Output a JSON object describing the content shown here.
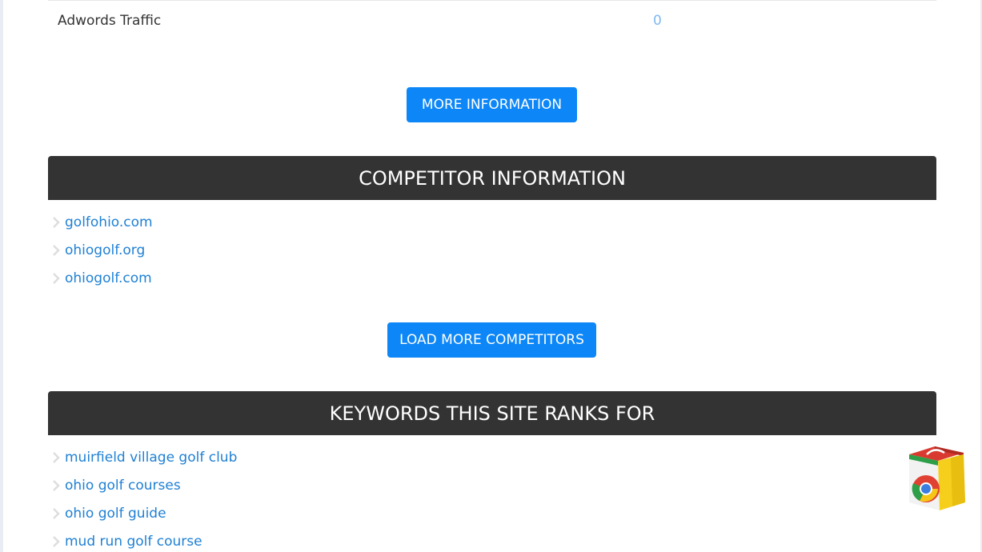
{
  "traffic": {
    "label": "Adwords Traffic",
    "value": "0"
  },
  "buttons": {
    "more_information": "MORE INFORMATION",
    "load_more_competitors": "LOAD MORE COMPETITORS"
  },
  "competitors": {
    "title": "COMPETITOR INFORMATION",
    "items": [
      "golfohio.com",
      "ohiogolf.org",
      "ohiogolf.com"
    ]
  },
  "keywords": {
    "title": "KEYWORDS THIS SITE RANKS FOR",
    "items": [
      "muirfield village golf club",
      "ohio golf courses",
      "ohio golf guide",
      "mud run golf course"
    ]
  },
  "icons": {
    "list_bullet": "chevron-right-icon",
    "store": "chrome-web-store-icon"
  },
  "colors": {
    "accent_button": "#0d87f7",
    "section_header": "#333333",
    "link": "#1f80d4",
    "value": "#7fb8ef"
  }
}
